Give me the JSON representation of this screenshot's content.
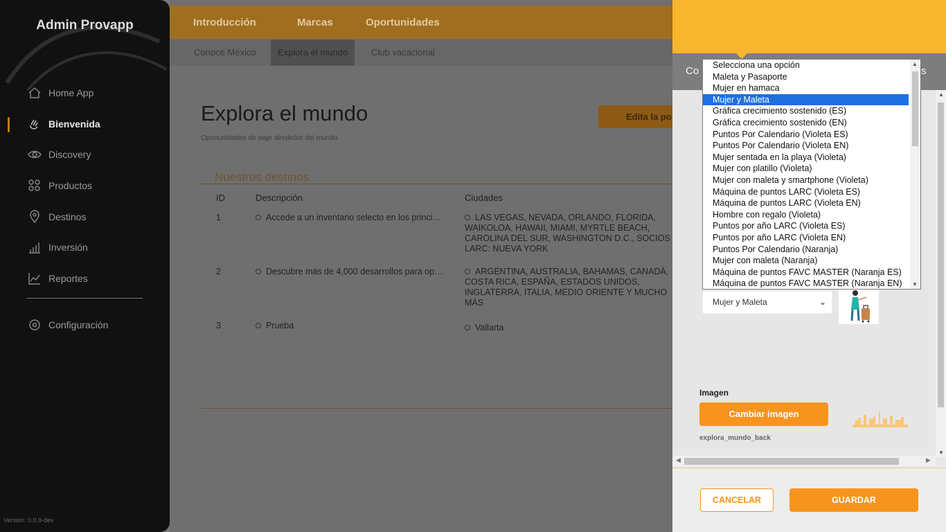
{
  "sidebar": {
    "brand": "Admin Provapp",
    "items": [
      {
        "label": "Home App",
        "icon": "home-icon"
      },
      {
        "label": "Bienvenida",
        "icon": "wave-hand-icon"
      },
      {
        "label": "Discovery",
        "icon": "eye-icon"
      },
      {
        "label": "Productos",
        "icon": "grid-icon"
      },
      {
        "label": "Destinos",
        "icon": "map-pin-icon"
      },
      {
        "label": "Inversión",
        "icon": "bar-chart-icon"
      },
      {
        "label": "Reportes",
        "icon": "line-chart-icon"
      }
    ],
    "config_label": "Configuración",
    "version": "Versión: 0.0.9-dev"
  },
  "topbar": {
    "tabs": [
      "Introducción",
      "Marcas",
      "Oportunidades"
    ]
  },
  "subbar": {
    "tabs": [
      "Conoce México",
      "Explora el mundo",
      "Club vacacional"
    ]
  },
  "main": {
    "title": "Explora el mundo",
    "subtitle": "Oportunidades de viaje alrededor del mundo.",
    "edit_button": "Edita la po",
    "section_title": "Nuestros destinos",
    "columns": [
      "ID",
      "Descripción",
      "Ciudades"
    ],
    "rows": [
      {
        "id": "1",
        "description": "Accede a un inventario selecto en los princi…",
        "cities": "LAS VEGAS, NEVADA, ORLANDO, FLORIDA, WAIKOLOA, HAWAII, MIAMI, MYRTLE BEACH, CAROLINA DEL SUR, WASHINGTON D.C., SOCIOS LARC: NUEVA YORK"
      },
      {
        "id": "2",
        "description": "Descubre más de 4,000 desarrollos para op…",
        "cities": "ARGENTINA, AUSTRALIA, BAHAMAS, CANADÁ, COSTA RICA, ESPAÑA, ESTADOS UNIDOS, INGLATERRA, ITALIA, MEDIO ORIENTE Y MUCHO MÁS"
      },
      {
        "id": "3",
        "description": "Prueba",
        "cities": "Vallarta"
      }
    ]
  },
  "panel": {
    "tab_left": "Co",
    "tab_right": "s",
    "select_value": "Mujer y Maleta",
    "image_label": "Imagen",
    "change_image_button": "Cambiar imagen",
    "file_name": "explora_mundo_back",
    "cancel_button": "CANCELAR",
    "save_button": "GUARDAR",
    "accent_color": "#f7941d",
    "header_color": "#f8b52e"
  },
  "dropdown": {
    "selected_index": 3,
    "options": [
      "Selecciona una opción",
      "Maleta y Pasaporte",
      "Mujer en hamaca",
      "Mujer y Maleta",
      "Gráfica crecimiento sostenido (ES)",
      "Gráfica crecimiento sostenido (EN)",
      "Puntos Por Calendario (Violeta ES)",
      "Puntos Por Calendario (Violeta EN)",
      "Mujer sentada en la playa (Violeta)",
      "Mujer con platillo (Violeta)",
      "Mujer con maleta y smartphone (Violeta)",
      "Máquina de puntos LARC (Violeta ES)",
      "Máquina de puntos LARC (Violeta EN)",
      "Hombre con regalo (Violeta)",
      "Puntos por año LARC (Violeta ES)",
      "Puntos por año LARC (Violeta EN)",
      "Puntos Por Calendario (Naranja)",
      "Mujer con maleta (Naranja)",
      "Máquina de puntos FAVC MASTER (Naranja ES)",
      "Máquina de puntos FAVC MASTER (Naranja EN)"
    ]
  }
}
